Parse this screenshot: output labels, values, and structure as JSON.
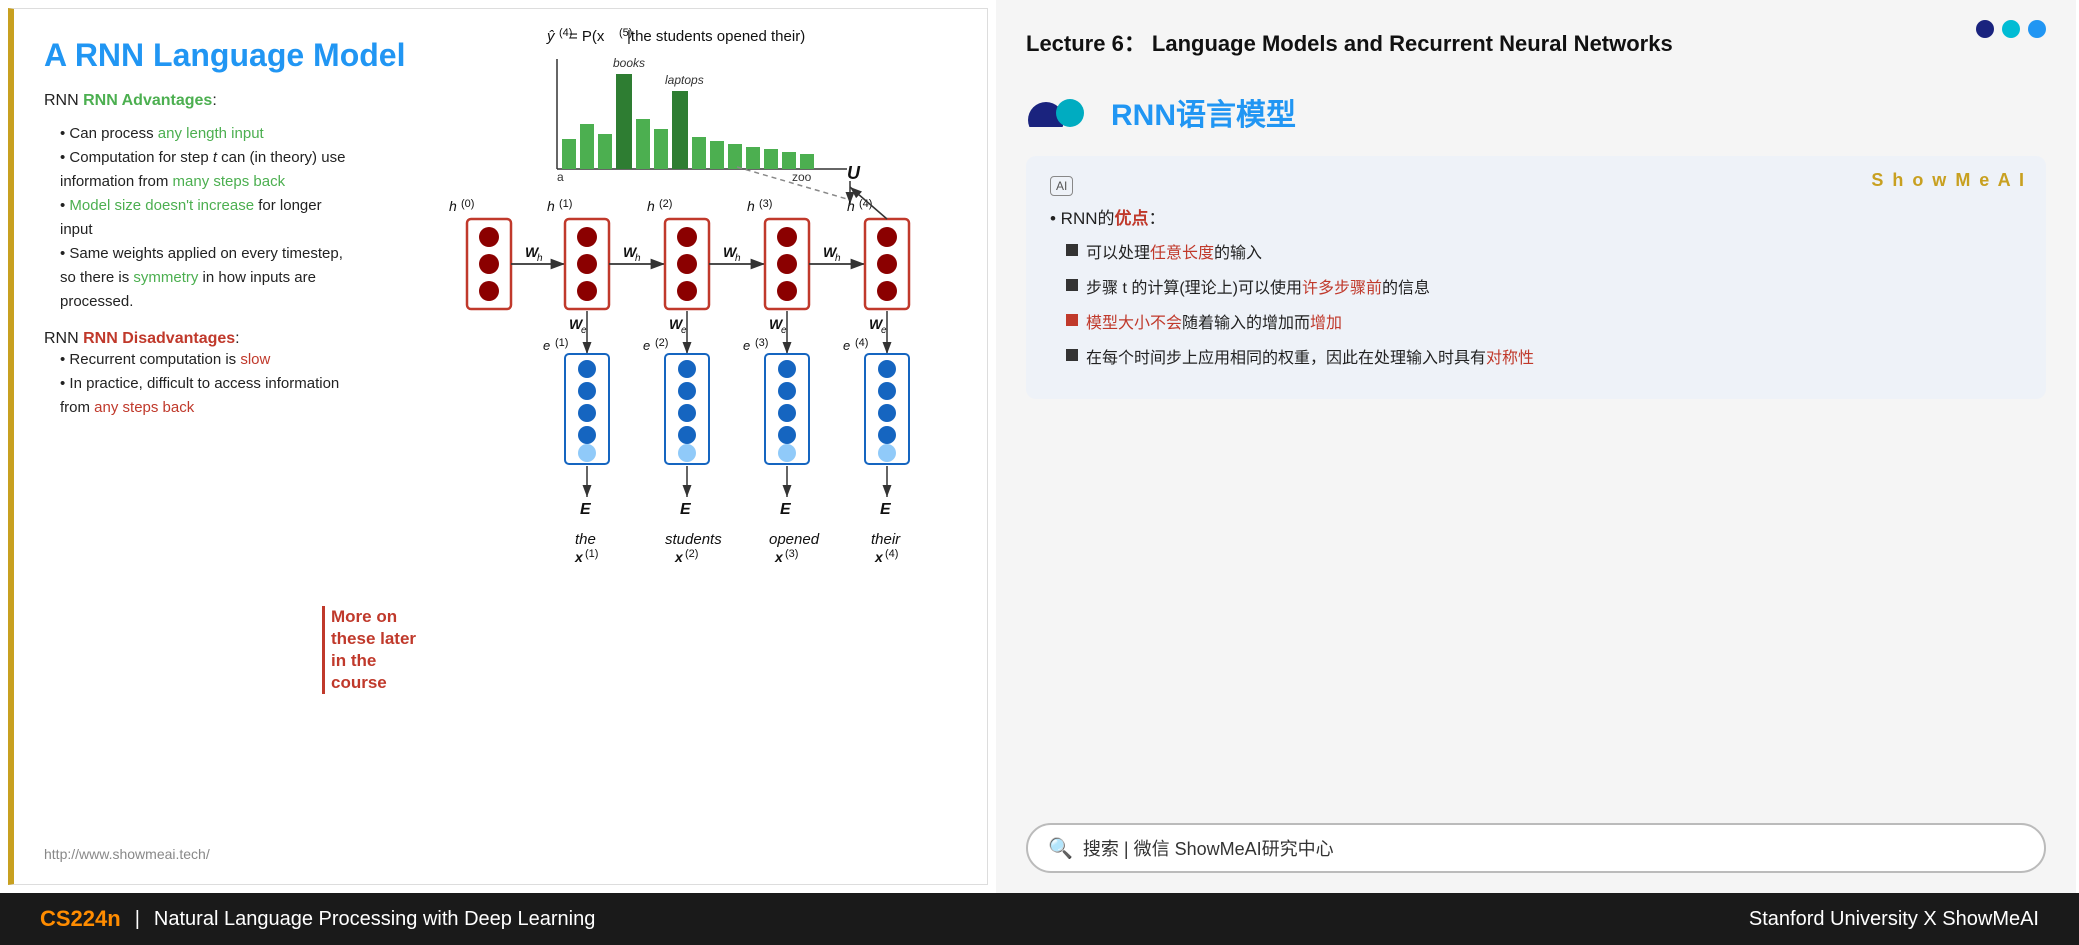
{
  "header": {
    "lecture_title": "Lecture 6： Language Models and Recurrent Neural Networks"
  },
  "left_slide": {
    "title": "A RNN Language Model",
    "advantages_label": "RNN Advantages",
    "advantages_colon": ":",
    "bullet1": "Can process ",
    "bullet1_green": "any length input",
    "bullet2_start": "Computation for step ",
    "bullet2_t": "t",
    "bullet2_end": " can (in theory) use information from ",
    "bullet2_green": "many steps back",
    "bullet3_green_start": "Model size doesn't",
    "bullet3_green_end": " increase",
    "bullet3_rest": " for longer input",
    "bullet4": "Same weights applied on every timestep, so there is ",
    "bullet4_green": "symmetry",
    "bullet4_end": " in how inputs are processed.",
    "disadvantages_label": "RNN Disadvantages",
    "disadvantages_colon": ":",
    "dbullet1_start": "Recurrent computation is ",
    "dbullet1_red": "slow",
    "dbullet2_start": "In practice, difficult to access information from ",
    "dbullet2_red": "any steps back",
    "more_on_later": "More on\nthese later\nin the\ncourse",
    "url": "http://www.showmeai.tech/",
    "formula": "ŷ(4) = P(x(5)|the students opened their)"
  },
  "diagram": {
    "h0": "h(0)",
    "h1": "h(1)",
    "h2": "h(2)",
    "h3": "h(3)",
    "h4": "h(4)",
    "Wh": "W_h",
    "We": "W_e",
    "E": "E",
    "U": "U",
    "e1": "e(1)",
    "e2": "e(2)",
    "e3": "e(3)",
    "e4": "e(4)",
    "word1": "the",
    "word1_x": "x(1)",
    "word2": "students",
    "word2_x": "x(2)",
    "word3": "opened",
    "word3_x": "x(3)",
    "word4": "their",
    "word4_x": "x(4)",
    "bar_label_a": "a",
    "bar_label_zoo": "zoo",
    "bar_label_books": "books",
    "bar_label_laptops": "laptops"
  },
  "right_panel": {
    "rnn_chinese_title": "RNN语言模型",
    "showmeai_brand": "S h o w M e A I",
    "ai_icon": "AI",
    "rnn_advantages_chinese": "RNN的优点：",
    "bullet1": "可以处理",
    "bullet1_red": "任意长度",
    "bullet1_end": "的输入",
    "bullet2_start": "步骤 t 的计算(理论上)可以使用",
    "bullet2_red": "许多步骤前",
    "bullet2_end": "的信息",
    "bullet3_red": "模型大小不会",
    "bullet3_end": "随着输入的增加而",
    "bullet3_red2": "增加",
    "bullet4": "在每个时间步上应用相同的权重，因此在处理输入时具有",
    "bullet4_red": "对称性",
    "search_text": "搜索 | 微信 ShowMeAI研究中心"
  },
  "footer": {
    "cs_label": "CS224n",
    "separator": "|",
    "course_title": "Natural Language Processing with Deep Learning",
    "right_text": "Stanford University  X  ShowMeAI"
  }
}
